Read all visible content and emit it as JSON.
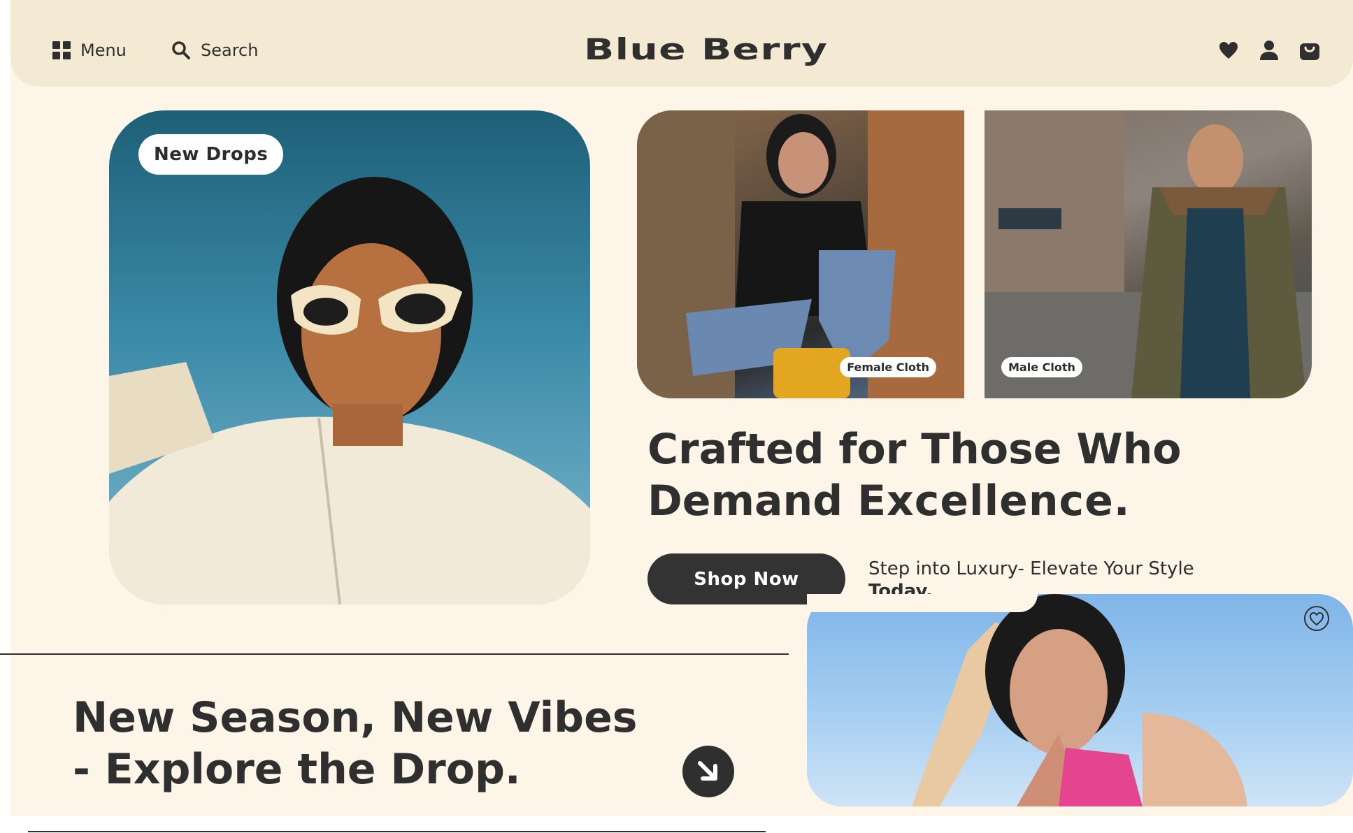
{
  "header": {
    "menu_label": "Menu",
    "search_label": "Search",
    "logo": "Blue Berry",
    "icons": [
      "heart-icon",
      "user-icon",
      "bag-icon"
    ]
  },
  "hero": {
    "badge": "New Drops",
    "female_label": "Female Cloth",
    "male_label": "Male Cloth"
  },
  "headline": {
    "line1": "Crafted for Those Who",
    "line2_regular": "Demand ",
    "line2_bold": "Excellence."
  },
  "cta": {
    "shop_label": "Shop Now",
    "tagline_regular": "Step into Luxury- Elevate Your Style ",
    "tagline_bold": "Today."
  },
  "promo": {
    "part1": "New ",
    "part2": "Season",
    "part3": ", New ",
    "part4": "Vibes",
    "part5": "- Explore ",
    "part6": "the Drop."
  },
  "colors": {
    "background": "#fdf6e8",
    "header": "#f4ead4",
    "dark": "#2f2f2f"
  }
}
